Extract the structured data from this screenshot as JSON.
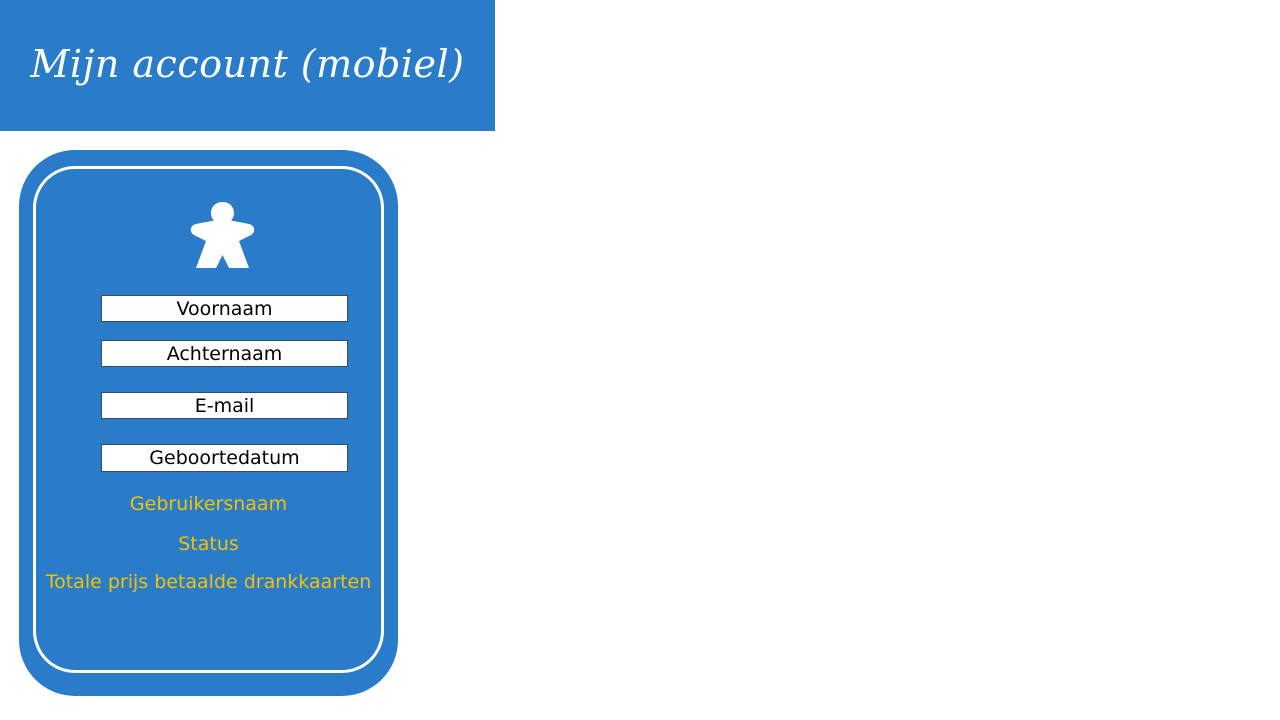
{
  "header": {
    "title": "Mijn account (mobiel)"
  },
  "colors": {
    "accent": "#2b7cc8",
    "info_text": "#f2c200",
    "field_background": "#ffffff"
  },
  "profile": {
    "avatar_icon": "meeple-icon",
    "fields": {
      "first_name": "Voornaam",
      "last_name": "Achternaam",
      "email": "E-mail",
      "birth_date": "Geboortedatum"
    },
    "info": {
      "username": "Gebruikersnaam",
      "status": "Status",
      "total_paid": "Totale prijs betaalde drankkaarten"
    }
  }
}
